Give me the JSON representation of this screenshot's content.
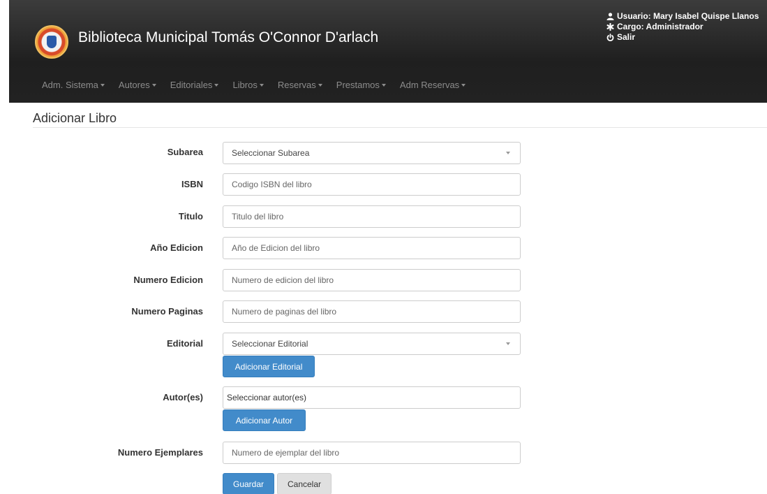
{
  "header": {
    "brand": "Biblioteca Municipal Tomás O'Connor D'arlach",
    "user_label": "Usuario: Mary Isabel Quispe Llanos",
    "role_label": "Cargo: Administrador",
    "logout_label": "Salir"
  },
  "nav": {
    "items": [
      {
        "label": "Adm. Sistema"
      },
      {
        "label": "Autores"
      },
      {
        "label": "Editoriales"
      },
      {
        "label": "Libros"
      },
      {
        "label": "Reservas"
      },
      {
        "label": "Prestamos"
      },
      {
        "label": "Adm Reservas"
      }
    ]
  },
  "page": {
    "title": "Adicionar Libro"
  },
  "form": {
    "subarea": {
      "label": "Subarea",
      "value": "Seleccionar Subarea"
    },
    "isbn": {
      "label": "ISBN",
      "placeholder": "Codigo ISBN del libro"
    },
    "titulo": {
      "label": "Titulo",
      "placeholder": "Titulo del libro"
    },
    "anio": {
      "label": "Año Edicion",
      "placeholder": "Año de Edicion del libro"
    },
    "num_edicion": {
      "label": "Numero Edicion",
      "placeholder": "Numero de edicion del libro"
    },
    "num_paginas": {
      "label": "Numero Paginas",
      "placeholder": "Numero de paginas del libro"
    },
    "editorial": {
      "label": "Editorial",
      "value": "Seleccionar Editorial",
      "add_button": "Adicionar Editorial"
    },
    "autores": {
      "label": "Autor(es)",
      "value": "Seleccionar autor(es)",
      "add_button": "Adicionar Autor"
    },
    "ejemplares": {
      "label": "Numero Ejemplares",
      "placeholder": "Numero de ejemplar del libro"
    },
    "save_button": "Guardar",
    "cancel_button": "Cancelar"
  },
  "colors": {
    "primary": "#428bca",
    "navbar": "#222222"
  }
}
